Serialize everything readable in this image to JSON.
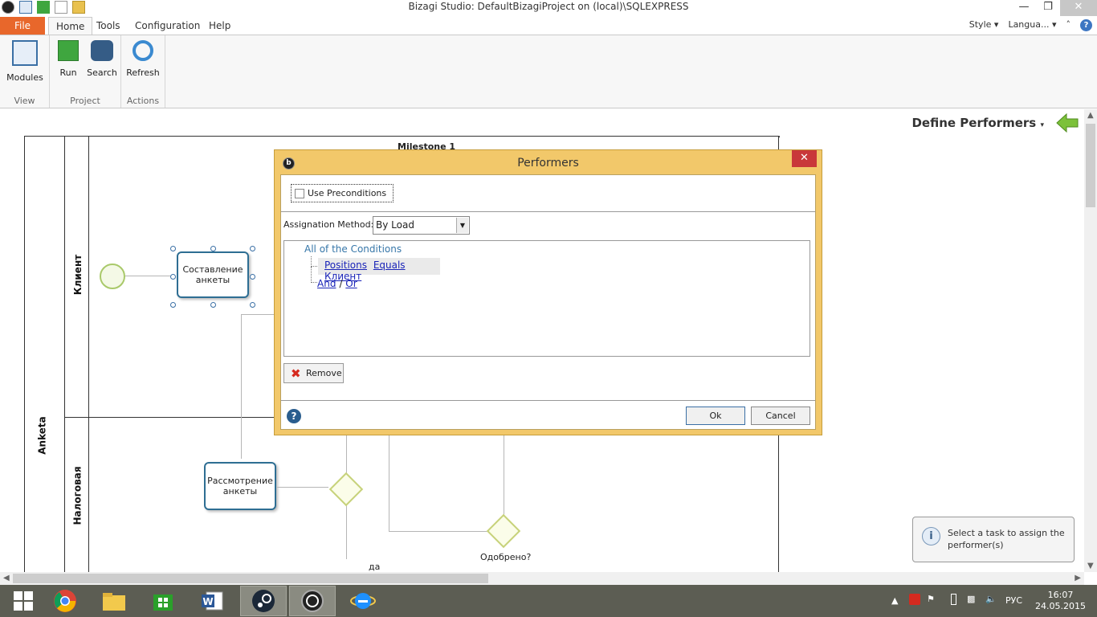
{
  "window": {
    "title": "Bizagi Studio: DefaultBizagiProject on (local)\\SQLEXPRESS"
  },
  "tabs": {
    "file": "File",
    "home": "Home",
    "tools": "Tools",
    "configuration": "Configuration",
    "help": "Help",
    "style": "Style",
    "language": "Langua..."
  },
  "ribbon": {
    "modules": "Modules",
    "view_group": "View",
    "run": "Run",
    "search": "Search",
    "project_group": "Project",
    "refresh": "Refresh",
    "actions_group": "Actions"
  },
  "canvas": {
    "define_performers": "Define Performers",
    "milestone": "Milestone 1",
    "pool": "Anketa",
    "lane1": "Клиент",
    "lane2": "Налоговая",
    "task1": "Составление анкеты",
    "task2": "Рассмотрение анкеты",
    "gateway_label": "Одобрено?",
    "flow_label": "да"
  },
  "dialog": {
    "title": "Performers",
    "use_preconditions": "Use Preconditions",
    "assignation_label": "Assignation Method:",
    "assignation_value": "By Load",
    "all_conditions": "All of the Conditions",
    "cond_positions": "Positions",
    "cond_equals": "Equals",
    "cond_value": "Клиент",
    "and": "And",
    "or": "Or",
    "remove": "Remove",
    "ok": "Ok",
    "cancel": "Cancel"
  },
  "info": {
    "text": "Select a task to assign the performer(s)"
  },
  "taskbar": {
    "lang": "РУС",
    "time": "16:07",
    "date": "24.05.2015"
  },
  "colors": {
    "file_tab": "#e8672b",
    "dialog_frame": "#f2c86a",
    "task_border": "#2e6e93",
    "taskbar": "#5c5d53"
  }
}
